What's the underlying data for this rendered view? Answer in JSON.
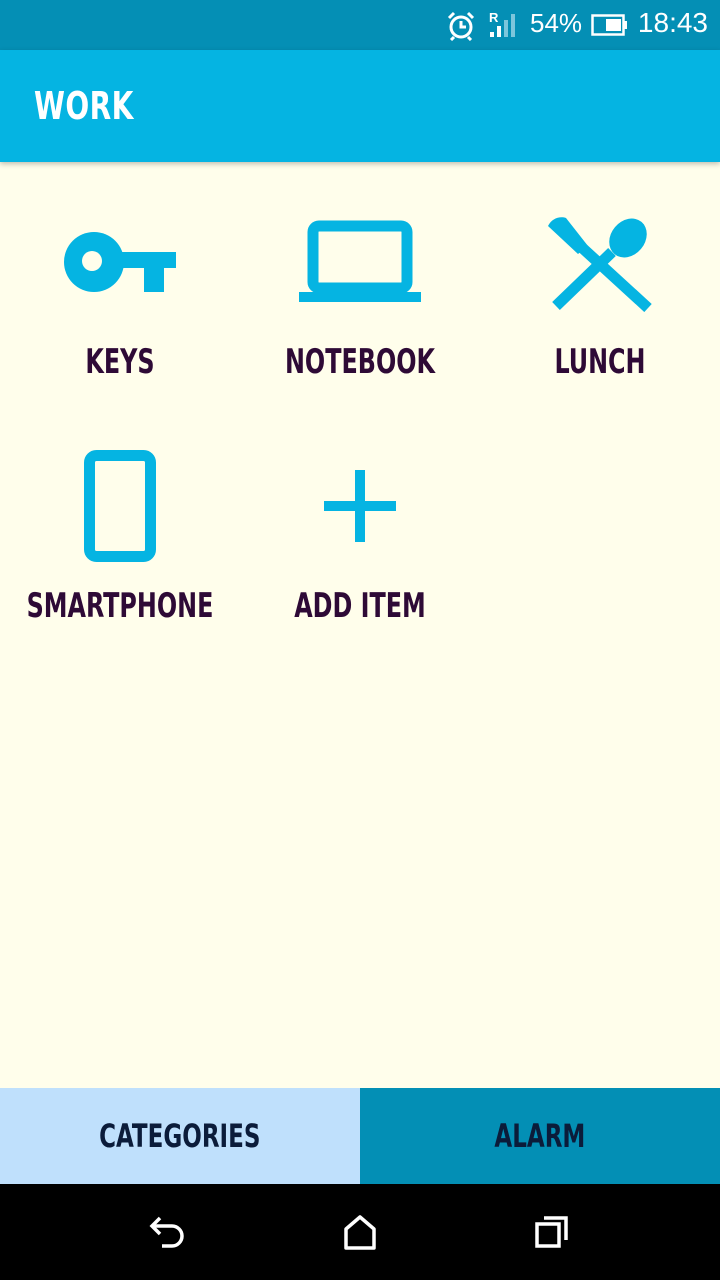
{
  "status_bar": {
    "battery_percent": "54%",
    "time": "18:43",
    "roaming_indicator": "R",
    "icons": [
      "alarm-clock-icon",
      "signal-roaming-icon",
      "battery-icon"
    ]
  },
  "app_bar": {
    "title": "WORK"
  },
  "items": [
    {
      "label": "KEYS",
      "icon": "key-icon"
    },
    {
      "label": "NOTEBOOK",
      "icon": "laptop-icon"
    },
    {
      "label": "LUNCH",
      "icon": "fork-spoon-icon"
    },
    {
      "label": "SMARTPHONE",
      "icon": "smartphone-icon"
    },
    {
      "label": "ADD ITEM",
      "icon": "plus-icon"
    }
  ],
  "bottom_tabs": [
    {
      "label": "CATEGORIES"
    },
    {
      "label": "ALARM"
    }
  ],
  "colors": {
    "accent": "#05b4e2",
    "status_bar": "#048fb5",
    "background": "#fffeeb",
    "label_text": "#2e0a36",
    "tab_categories": "#bfe0fc",
    "tab_alarm": "#038fb5"
  },
  "nav_bar": {
    "buttons": [
      "back-icon",
      "home-icon",
      "recent-apps-icon"
    ]
  }
}
